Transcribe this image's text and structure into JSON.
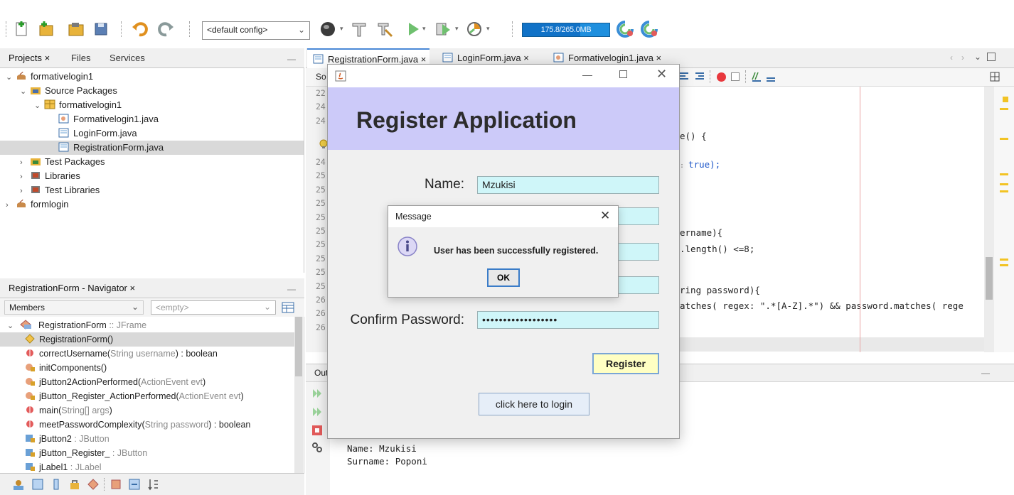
{
  "toolbar": {
    "config": "<default config>",
    "memory": "175.8/265.0MB",
    "memory_used_fraction": 0.66
  },
  "projects": {
    "tabs": [
      "Projects ×",
      "Files",
      "Services"
    ],
    "tree": [
      {
        "label": "formativelogin1",
        "level": 0,
        "icon": "project-icon",
        "expanded": true
      },
      {
        "label": "Source Packages",
        "level": 1,
        "icon": "source-packages-icon",
        "expanded": true
      },
      {
        "label": "formativelogin1",
        "level": 2,
        "icon": "package-icon",
        "expanded": true
      },
      {
        "label": "Formativelogin1.java",
        "level": 3,
        "icon": "java-file-icon"
      },
      {
        "label": "LoginForm.java",
        "level": 3,
        "icon": "java-form-icon"
      },
      {
        "label": "RegistrationForm.java",
        "level": 3,
        "icon": "java-form-icon",
        "selected": true
      },
      {
        "label": "Test Packages",
        "level": 1,
        "icon": "test-packages-icon",
        "expanded": false
      },
      {
        "label": "Libraries",
        "level": 1,
        "icon": "libraries-icon",
        "expanded": false
      },
      {
        "label": "Test Libraries",
        "level": 1,
        "icon": "test-libraries-icon",
        "expanded": false
      },
      {
        "label": "formlogin",
        "level": 0,
        "icon": "project-icon",
        "expanded": false
      }
    ]
  },
  "navigator": {
    "title": "RegistrationForm - Navigator ×",
    "members_label": "Members",
    "filter_placeholder": "<empty>",
    "root": {
      "name": "RegistrationForm",
      "type": " :: JFrame"
    },
    "items": [
      {
        "name": "RegistrationForm()",
        "detail": "",
        "icon": "constructor-icon",
        "selected": true
      },
      {
        "name": "correctUsername(",
        "params": "String username",
        "detail": ") : boolean",
        "icon": "method-icon"
      },
      {
        "name": "initComponents()",
        "params": "",
        "detail": "",
        "icon": "private-method-icon"
      },
      {
        "name": "jButton2ActionPerformed(",
        "params": "ActionEvent evt",
        "detail": ")",
        "icon": "private-method-icon"
      },
      {
        "name": "jButton_Register_ActionPerformed(",
        "params": "ActionEvent evt",
        "detail": ")",
        "icon": "private-method-icon"
      },
      {
        "name": "main(",
        "params": "String[] args",
        "detail": ")",
        "icon": "method-icon"
      },
      {
        "name": "meetPasswordComplexity(",
        "params": "String password",
        "detail": ") : boolean",
        "icon": "method-icon"
      },
      {
        "name": "jButton2",
        "params": "",
        "detail": " : JButton",
        "icon": "field-icon"
      },
      {
        "name": "jButton_Register_",
        "params": "",
        "detail": " : JButton",
        "icon": "field-icon"
      },
      {
        "name": "jLabel1",
        "params": "",
        "detail": " : JLabel",
        "icon": "field-icon"
      }
    ]
  },
  "editor": {
    "tabs": [
      "RegistrationForm.java ×",
      "LoginForm.java ×",
      "Formativelogin1.java ×"
    ],
    "source_tab": "So",
    "line_numbers": [
      "22",
      "24",
      "24",
      "",
      "",
      "24",
      "25",
      "25",
      "25",
      "25",
      "25",
      "25",
      "25",
      "25",
      "25",
      "26",
      "26",
      "26"
    ],
    "code": [
      "e() {",
      "true);",
      "ername){",
      ".length() <=8;",
      "ring password){",
      "atches( regex: \".*[A-Z].*\") && password.matches( rege"
    ]
  },
  "output": {
    "tab": "Out",
    "lines": [
      "Name: Mzukisi",
      "Surname: Poponi"
    ]
  },
  "register_window": {
    "banner_title": "Register Application",
    "name_label": "Name:",
    "name_value": "Mzukisi",
    "confirm_label": "Confirm Password:",
    "confirm_value": "••••••••••••••••••",
    "register_label": "Register",
    "login_label": "click here to login"
  },
  "message_dialog": {
    "title": "Message",
    "text": "User has been successfully registered.",
    "ok_label": "OK"
  }
}
